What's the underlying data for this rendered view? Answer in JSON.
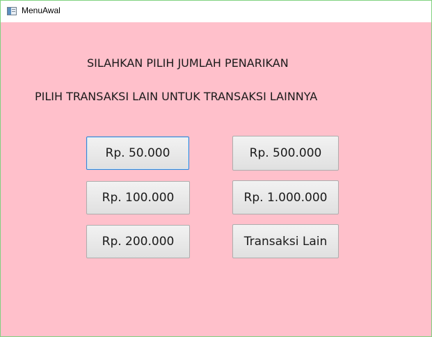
{
  "window": {
    "title": "MenuAwal",
    "icon": "java-window-icon"
  },
  "content": {
    "instruction_1": "SILAHKAN PILIH JUMLAH PENARIKAN",
    "instruction_2": "PILIH TRANSAKSI LAIN UNTUK TRANSAKSI LAINNYA",
    "background_color": "#ffc0cb"
  },
  "buttons": {
    "amount_50000": "Rp. 50.000",
    "amount_500000": "Rp. 500.000",
    "amount_100000": "Rp. 100.000",
    "amount_1000000": "Rp. 1.000.000",
    "amount_200000": "Rp. 200.000",
    "other_transaction": "Transaksi Lain"
  }
}
